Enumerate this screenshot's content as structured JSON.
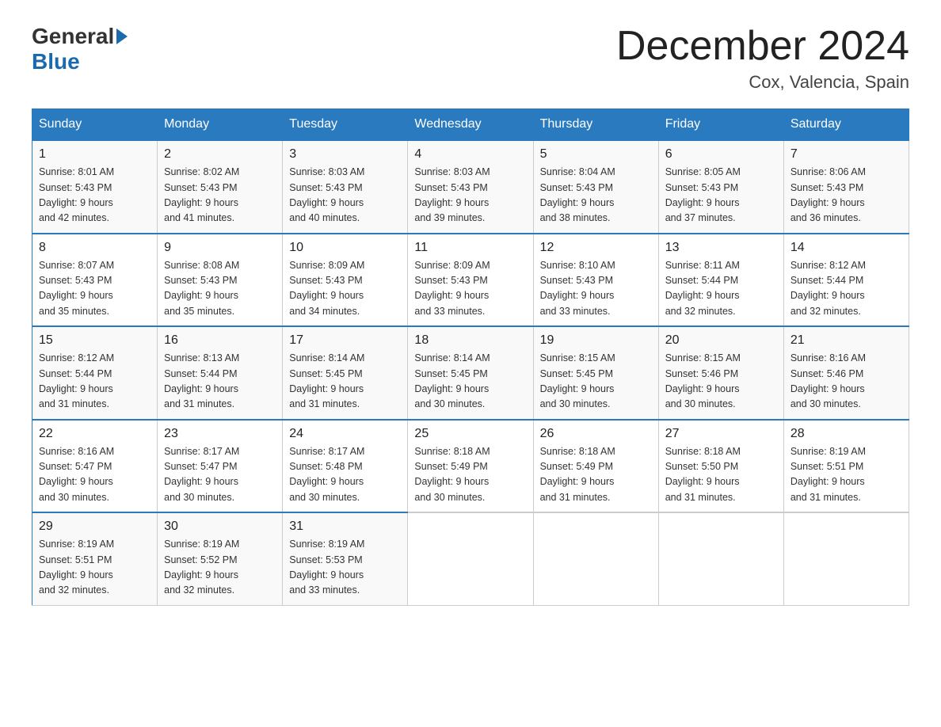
{
  "header": {
    "logo_general": "General",
    "logo_blue": "Blue",
    "month_title": "December 2024",
    "location": "Cox, Valencia, Spain"
  },
  "days_of_week": [
    "Sunday",
    "Monday",
    "Tuesday",
    "Wednesday",
    "Thursday",
    "Friday",
    "Saturday"
  ],
  "weeks": [
    [
      {
        "day": "1",
        "sunrise": "8:01 AM",
        "sunset": "5:43 PM",
        "daylight": "9 hours and 42 minutes."
      },
      {
        "day": "2",
        "sunrise": "8:02 AM",
        "sunset": "5:43 PM",
        "daylight": "9 hours and 41 minutes."
      },
      {
        "day": "3",
        "sunrise": "8:03 AM",
        "sunset": "5:43 PM",
        "daylight": "9 hours and 40 minutes."
      },
      {
        "day": "4",
        "sunrise": "8:03 AM",
        "sunset": "5:43 PM",
        "daylight": "9 hours and 39 minutes."
      },
      {
        "day": "5",
        "sunrise": "8:04 AM",
        "sunset": "5:43 PM",
        "daylight": "9 hours and 38 minutes."
      },
      {
        "day": "6",
        "sunrise": "8:05 AM",
        "sunset": "5:43 PM",
        "daylight": "9 hours and 37 minutes."
      },
      {
        "day": "7",
        "sunrise": "8:06 AM",
        "sunset": "5:43 PM",
        "daylight": "9 hours and 36 minutes."
      }
    ],
    [
      {
        "day": "8",
        "sunrise": "8:07 AM",
        "sunset": "5:43 PM",
        "daylight": "9 hours and 35 minutes."
      },
      {
        "day": "9",
        "sunrise": "8:08 AM",
        "sunset": "5:43 PM",
        "daylight": "9 hours and 35 minutes."
      },
      {
        "day": "10",
        "sunrise": "8:09 AM",
        "sunset": "5:43 PM",
        "daylight": "9 hours and 34 minutes."
      },
      {
        "day": "11",
        "sunrise": "8:09 AM",
        "sunset": "5:43 PM",
        "daylight": "9 hours and 33 minutes."
      },
      {
        "day": "12",
        "sunrise": "8:10 AM",
        "sunset": "5:43 PM",
        "daylight": "9 hours and 33 minutes."
      },
      {
        "day": "13",
        "sunrise": "8:11 AM",
        "sunset": "5:44 PM",
        "daylight": "9 hours and 32 minutes."
      },
      {
        "day": "14",
        "sunrise": "8:12 AM",
        "sunset": "5:44 PM",
        "daylight": "9 hours and 32 minutes."
      }
    ],
    [
      {
        "day": "15",
        "sunrise": "8:12 AM",
        "sunset": "5:44 PM",
        "daylight": "9 hours and 31 minutes."
      },
      {
        "day": "16",
        "sunrise": "8:13 AM",
        "sunset": "5:44 PM",
        "daylight": "9 hours and 31 minutes."
      },
      {
        "day": "17",
        "sunrise": "8:14 AM",
        "sunset": "5:45 PM",
        "daylight": "9 hours and 31 minutes."
      },
      {
        "day": "18",
        "sunrise": "8:14 AM",
        "sunset": "5:45 PM",
        "daylight": "9 hours and 30 minutes."
      },
      {
        "day": "19",
        "sunrise": "8:15 AM",
        "sunset": "5:45 PM",
        "daylight": "9 hours and 30 minutes."
      },
      {
        "day": "20",
        "sunrise": "8:15 AM",
        "sunset": "5:46 PM",
        "daylight": "9 hours and 30 minutes."
      },
      {
        "day": "21",
        "sunrise": "8:16 AM",
        "sunset": "5:46 PM",
        "daylight": "9 hours and 30 minutes."
      }
    ],
    [
      {
        "day": "22",
        "sunrise": "8:16 AM",
        "sunset": "5:47 PM",
        "daylight": "9 hours and 30 minutes."
      },
      {
        "day": "23",
        "sunrise": "8:17 AM",
        "sunset": "5:47 PM",
        "daylight": "9 hours and 30 minutes."
      },
      {
        "day": "24",
        "sunrise": "8:17 AM",
        "sunset": "5:48 PM",
        "daylight": "9 hours and 30 minutes."
      },
      {
        "day": "25",
        "sunrise": "8:18 AM",
        "sunset": "5:49 PM",
        "daylight": "9 hours and 30 minutes."
      },
      {
        "day": "26",
        "sunrise": "8:18 AM",
        "sunset": "5:49 PM",
        "daylight": "9 hours and 31 minutes."
      },
      {
        "day": "27",
        "sunrise": "8:18 AM",
        "sunset": "5:50 PM",
        "daylight": "9 hours and 31 minutes."
      },
      {
        "day": "28",
        "sunrise": "8:19 AM",
        "sunset": "5:51 PM",
        "daylight": "9 hours and 31 minutes."
      }
    ],
    [
      {
        "day": "29",
        "sunrise": "8:19 AM",
        "sunset": "5:51 PM",
        "daylight": "9 hours and 32 minutes."
      },
      {
        "day": "30",
        "sunrise": "8:19 AM",
        "sunset": "5:52 PM",
        "daylight": "9 hours and 32 minutes."
      },
      {
        "day": "31",
        "sunrise": "8:19 AM",
        "sunset": "5:53 PM",
        "daylight": "9 hours and 33 minutes."
      },
      null,
      null,
      null,
      null
    ]
  ]
}
